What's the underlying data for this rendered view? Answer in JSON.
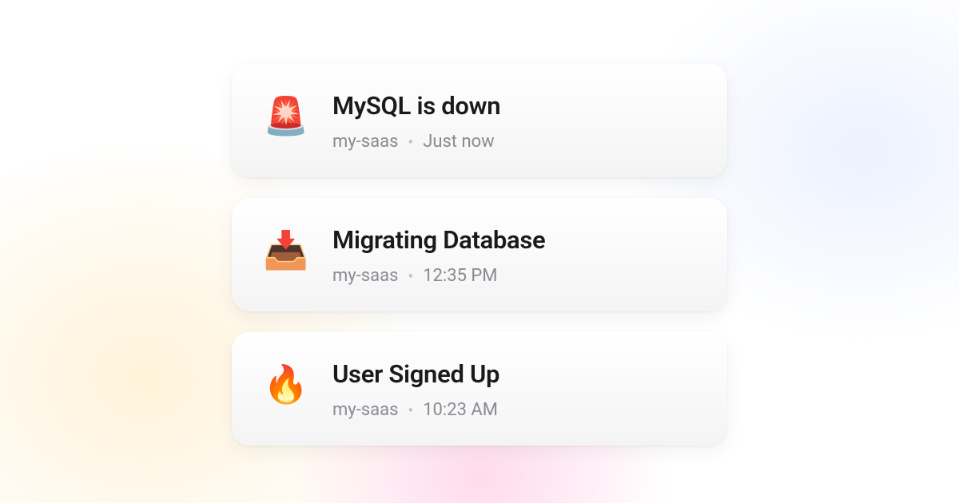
{
  "notifications": [
    {
      "icon": "🚨",
      "icon_name": "siren-icon",
      "title": "MySQL is down",
      "project": "my-saas",
      "time": "Just now"
    },
    {
      "icon": "📥",
      "icon_name": "inbox-download-icon",
      "title": "Migrating Database",
      "project": "my-saas",
      "time": "12:35 PM"
    },
    {
      "icon": "🔥",
      "icon_name": "fire-icon",
      "title": "User Signed Up",
      "project": "my-saas",
      "time": "10:23 AM"
    }
  ],
  "separator": "•"
}
